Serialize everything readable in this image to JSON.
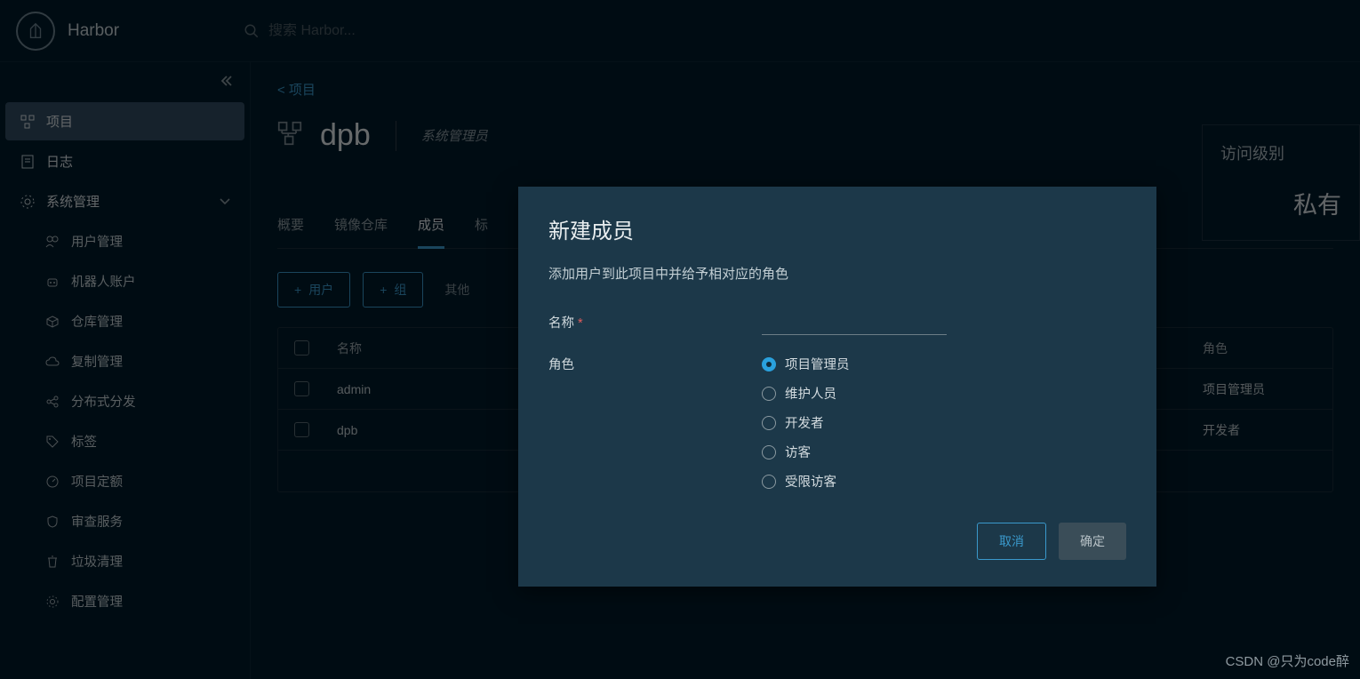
{
  "header": {
    "product_name": "Harbor",
    "search_placeholder": "搜索 Harbor..."
  },
  "sidebar": {
    "items": [
      {
        "label": "项目"
      },
      {
        "label": "日志"
      },
      {
        "label": "系统管理"
      }
    ],
    "sub_items": [
      {
        "label": "用户管理"
      },
      {
        "label": "机器人账户"
      },
      {
        "label": "仓库管理"
      },
      {
        "label": "复制管理"
      },
      {
        "label": "分布式分发"
      },
      {
        "label": "标签"
      },
      {
        "label": "项目定额"
      },
      {
        "label": "审查服务"
      },
      {
        "label": "垃圾清理"
      },
      {
        "label": "配置管理"
      }
    ]
  },
  "breadcrumb": {
    "back_label": "< 项目"
  },
  "project": {
    "name": "dpb",
    "role_label": "系统管理员"
  },
  "access": {
    "label": "访问级别",
    "value": "私有"
  },
  "tabs": [
    {
      "label": "概要"
    },
    {
      "label": "镜像仓库"
    },
    {
      "label": "成员"
    },
    {
      "label": "标"
    }
  ],
  "actions": {
    "user_btn": "用户",
    "group_btn": "组",
    "other_label": "其他"
  },
  "table": {
    "col_name": "名称",
    "col_role": "角色",
    "rows": [
      {
        "name": "admin",
        "role": "项目管理员"
      },
      {
        "name": "dpb",
        "role": "开发者"
      }
    ]
  },
  "modal": {
    "title": "新建成员",
    "desc": "添加用户到此项目中并给予相对应的角色",
    "name_label": "名称",
    "role_label": "角色",
    "roles": [
      {
        "label": "项目管理员",
        "checked": true
      },
      {
        "label": "维护人员",
        "checked": false
      },
      {
        "label": "开发者",
        "checked": false
      },
      {
        "label": "访客",
        "checked": false
      },
      {
        "label": "受限访客",
        "checked": false
      }
    ],
    "cancel": "取消",
    "confirm": "确定"
  },
  "watermark": "CSDN @只为code醉"
}
